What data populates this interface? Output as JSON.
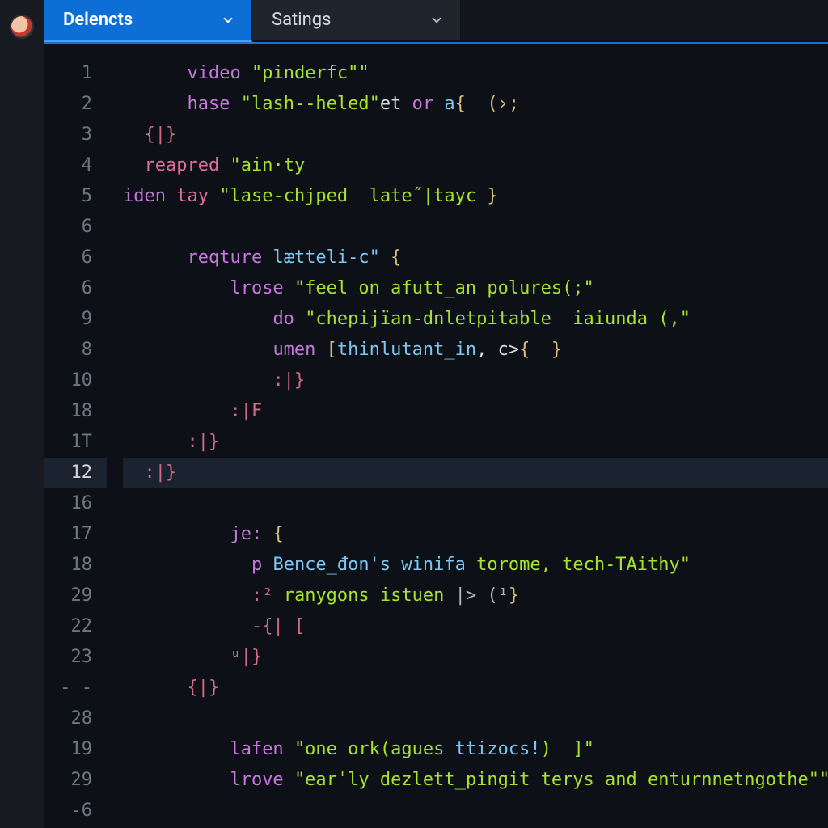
{
  "tabs": [
    {
      "label": "Delencts",
      "active": true
    },
    {
      "label": "Satings",
      "active": false
    }
  ],
  "gutter": [
    "1",
    "2",
    "3",
    "4",
    "5",
    "6",
    "6",
    "6",
    "9",
    "8",
    "10",
    "18",
    "1T",
    "12",
    "16",
    "17",
    "18",
    "29",
    "22",
    "23",
    "- -",
    "28",
    "19",
    "29",
    "-6"
  ],
  "gutter_highlight_index": 13,
  "code": {
    "l1": {
      "indent": "      ",
      "kw": "video ",
      "str": "\"pinderfc\"\""
    },
    "l2": {
      "indent": "      ",
      "kw": "hase ",
      "str": "\"lash--heled\"",
      "tail_pl": "et ",
      "tail_kw": "or ",
      "tail_id": "a",
      "tail_br": "{  (›;"
    },
    "l3": {
      "indent": "  ",
      "punc": "{|}"
    },
    "l4": {
      "indent": "  ",
      "kw": "reapred ",
      "str": "\"ain·ty"
    },
    "l5": {
      "kw": "iden ",
      "kw2": "tay ",
      "str": "\"lase-chjped  late˝|tayc ",
      "br": "}"
    },
    "l6": {
      "indent": ""
    },
    "l7": {
      "indent": "      ",
      "kw": "reqture ",
      "id": "lætteli-c\" ",
      "br": "{"
    },
    "l8": {
      "indent": "          ",
      "kw": "lrose ",
      "str": "\"feel on afutt_an polures(;\""
    },
    "l9": {
      "indent": "              ",
      "kw": "do ",
      "str": "\"chepijïan-dnletpitable  iaiunda (,\""
    },
    "l10": {
      "indent": "              ",
      "kw": "umen ",
      "br1": "[",
      "id": "thinlutant_in",
      "pl": ", c>",
      "br2": "{  }"
    },
    "l11": {
      "indent": "              ",
      "punc": ":|}"
    },
    "l12": {
      "indent": "          ",
      "punc": ":|F"
    },
    "l13": {
      "indent": "      ",
      "punc": ":|}"
    },
    "l14": {
      "indent": "  ",
      "punc": ":|}"
    },
    "l15": {
      "indent": ""
    },
    "l16": {
      "indent": "          ",
      "kw": "je: ",
      "br": "{"
    },
    "l17": {
      "indent": "            ",
      "kw": "p ",
      "id": "Bence_đon's winifa ",
      "str": "torome, tech-TAithy\""
    },
    "l18": {
      "indent": "            ",
      "punc": ":² ",
      "str": "ranygons istuen ",
      "op": "|> (¹",
      "br": "}"
    },
    "l19": {
      "indent": "            ",
      "punc": "-{| ["
    },
    "l20": {
      "indent": "          ",
      "punc": "ᵘ|}"
    },
    "l21": {
      "indent": "      ",
      "punc": "{|}"
    },
    "l22": {
      "indent": ""
    },
    "l23": {
      "indent": "          ",
      "kw": "lafen ",
      "str": "\"one ork(agues ",
      "id": "ttizocs!",
      "str2": ")  ]\""
    },
    "l24": {
      "indent": "          ",
      "kw": "lrove ",
      "str": "\"earˈly dezlett_pingit terys and enturnnetngothe\"\"'",
      "pl": ","
    }
  }
}
